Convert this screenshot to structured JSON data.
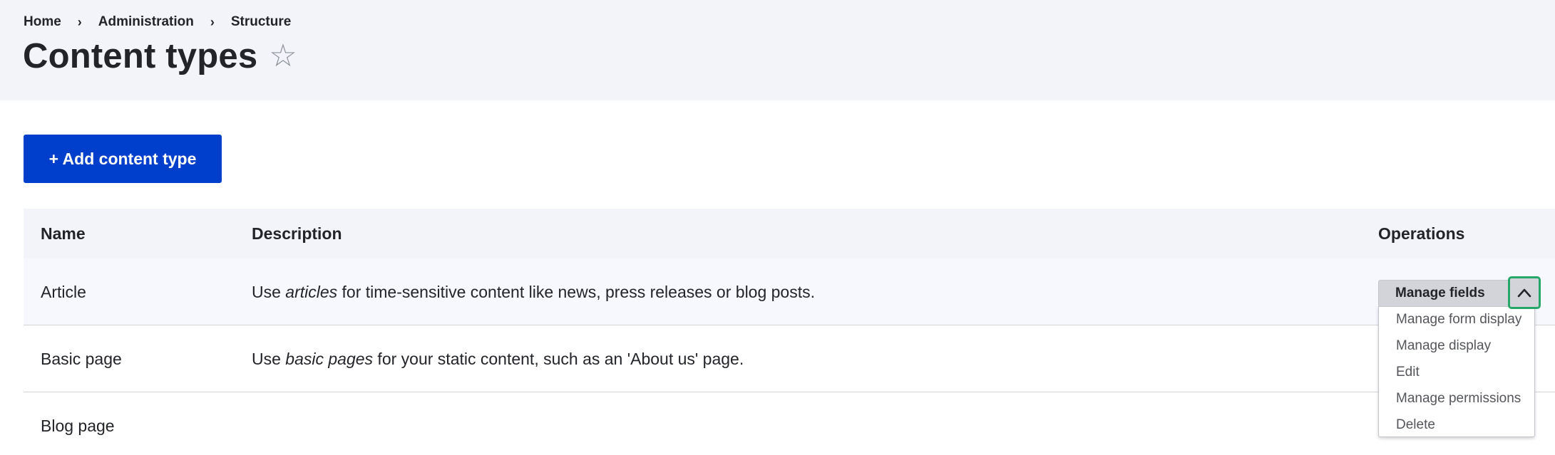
{
  "breadcrumb": {
    "items": [
      "Home",
      "Administration",
      "Structure"
    ],
    "separator": "›"
  },
  "page": {
    "title": "Content types",
    "favorite_glyph": "☆"
  },
  "actions": {
    "add_label": "+ Add content type"
  },
  "table": {
    "headers": {
      "name": "Name",
      "description": "Description",
      "operations": "Operations"
    },
    "rows": [
      {
        "name": "Article",
        "desc_before": "Use ",
        "desc_em": "articles",
        "desc_after": " for time-sensitive content like news, press releases or blog posts."
      },
      {
        "name": "Basic page",
        "desc_before": "Use ",
        "desc_em": "basic pages",
        "desc_after": " for your static content, such as an 'About us' page."
      },
      {
        "name": "Blog page",
        "desc_before": "",
        "desc_em": "",
        "desc_after": ""
      }
    ]
  },
  "operations_dropdown": {
    "primary_label": "Manage fields",
    "toggle_icon": "chevron-up-icon",
    "items": [
      "Manage form display",
      "Manage display",
      "Edit",
      "Manage permissions",
      "Delete"
    ]
  },
  "colors": {
    "primary_button": "#003ecc",
    "header_background": "#f3f4f9",
    "focus_ring": "#26a769",
    "highlighted_row": "#f6f8fd"
  }
}
